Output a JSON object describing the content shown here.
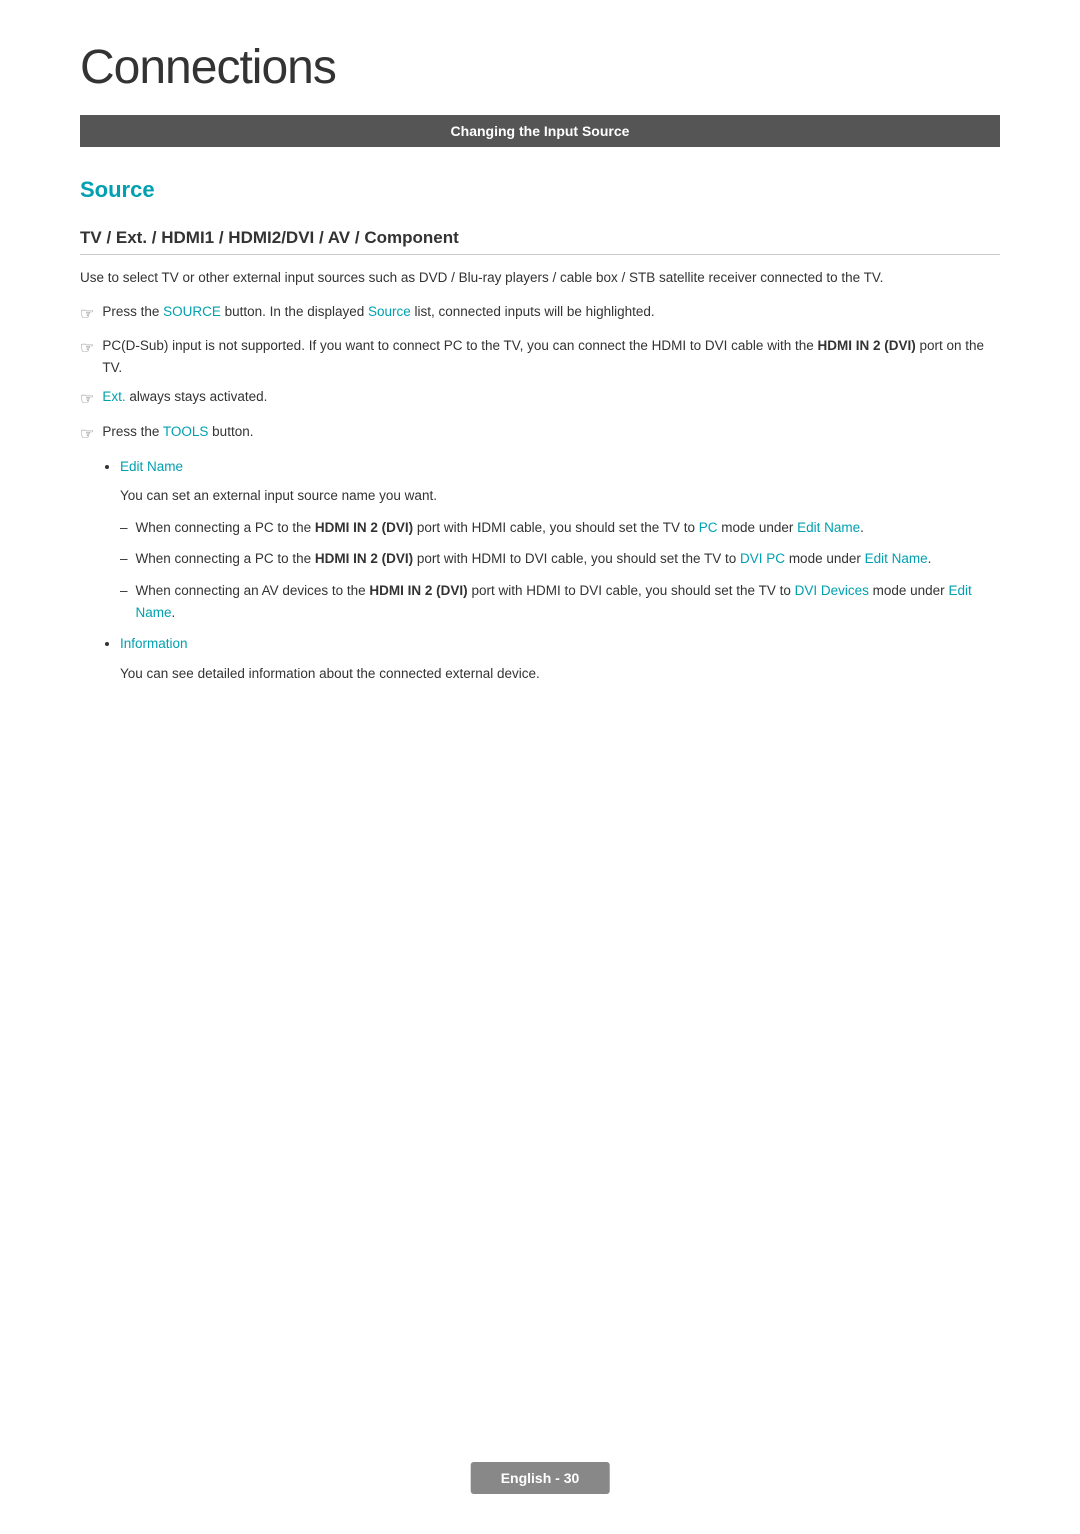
{
  "page": {
    "title": "Connections",
    "section_header": "Changing the Input Source",
    "source_heading": "Source",
    "subsection_title": "TV / Ext. / HDMI1 / HDMI2/DVI / AV / Component",
    "description": "Use to select TV or other external input sources such as DVD / Blu-ray players / cable box / STB satellite receiver connected to the TV.",
    "notes": [
      {
        "id": "note1",
        "text_before": "Press the ",
        "link1": "SOURCE",
        "text_middle": " button. In the displayed ",
        "link2": "Source",
        "text_after": " list, connected inputs will be highlighted."
      },
      {
        "id": "note2",
        "text": "PC(D-Sub) input is not supported. If you want to connect PC to the TV, you can connect the HDMI to DVI cable with the ",
        "bold": "HDMI IN 2 (DVI)",
        "text_after": " port on the TV."
      },
      {
        "id": "note3",
        "text_before": "",
        "link1": "Ext.",
        "text_after": " always stays activated."
      },
      {
        "id": "note4",
        "text_before": "Press the ",
        "link1": "TOOLS",
        "text_after": " button."
      }
    ],
    "bullet_items": [
      {
        "id": "bullet1",
        "label": "Edit Name",
        "indent_text": "You can set an external input source name you want."
      },
      {
        "id": "bullet2",
        "label": "Information",
        "indent_text": "You can see detailed information about the connected external device."
      }
    ],
    "dash_items": [
      {
        "id": "dash1",
        "text_before": "When connecting a PC to the ",
        "bold": "HDMI IN 2 (DVI)",
        "text_middle": " port with HDMI cable, you should set the TV to ",
        "link1": "PC",
        "text_after": " mode under ",
        "link2": "Edit Name",
        "text_end": "."
      },
      {
        "id": "dash2",
        "text_before": "When connecting a PC to the ",
        "bold": "HDMI IN 2 (DVI)",
        "text_middle": " port with HDMI to DVI cable, you should set the TV to ",
        "link1": "DVI PC",
        "text_after": " mode under ",
        "link2": "Edit Name",
        "text_end": "."
      },
      {
        "id": "dash3",
        "text_before": "When connecting an AV devices to the ",
        "bold": "HDMI IN 2 (DVI)",
        "text_middle": " port with HDMI to DVI cable, you should set the TV to ",
        "link1": "DVI Devices",
        "text_after": " mode under ",
        "link2": "Edit Name",
        "text_end": "."
      }
    ],
    "footer": {
      "label": "English - 30"
    },
    "colors": {
      "cyan": "#00a0b0",
      "dark_header": "#555555",
      "text": "#333333"
    }
  }
}
